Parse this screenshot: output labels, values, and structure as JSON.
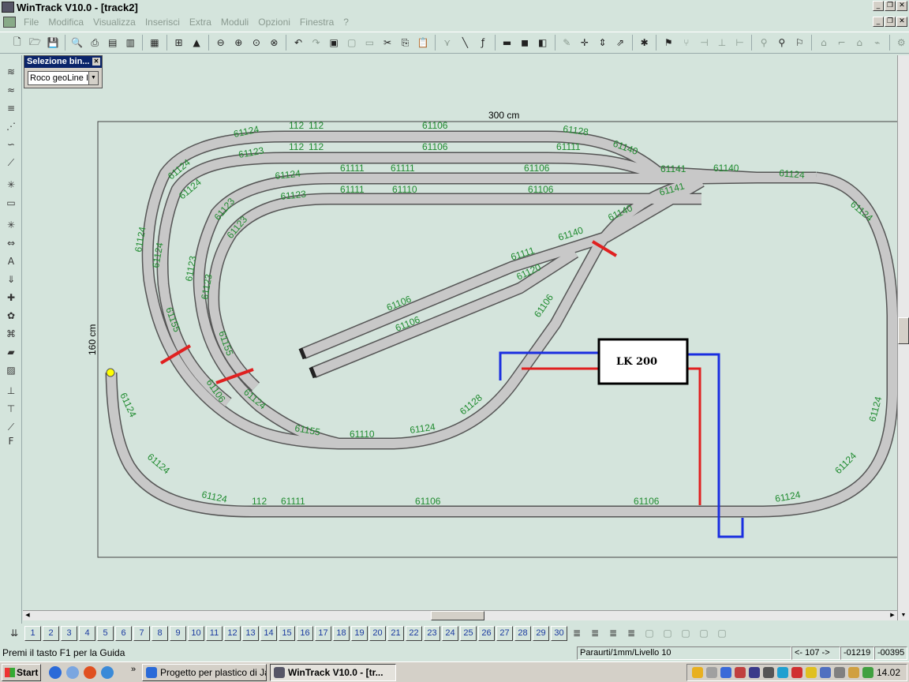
{
  "window": {
    "title": "WinTrack  V10.0 - [track2]"
  },
  "menu": {
    "items": [
      "File",
      "Modifica",
      "Visualizza",
      "Inserisci",
      "Extra",
      "Moduli",
      "Opzioni",
      "Finestra",
      "?"
    ]
  },
  "selection_panel": {
    "title": "Selezione bin...",
    "selected": "Roco geoLine I"
  },
  "dimensions": {
    "width_label": "300 cm",
    "height_label": "160 cm"
  },
  "controller": {
    "label": "LK 200"
  },
  "track_labels": {
    "outer_top": [
      "61124",
      "112",
      "112",
      "61106",
      "61128",
      "61140"
    ],
    "second_top": [
      "61123",
      "112",
      "112",
      "61106",
      "61111",
      "61141",
      "61140"
    ],
    "third_top": [
      "61124",
      "61111",
      "61111",
      "61106"
    ],
    "fourth_top": [
      "61123",
      "61111",
      "61110",
      "61106",
      "61141"
    ],
    "left_curves": [
      "61124",
      "61124",
      "61124",
      "61124",
      "61123",
      "61123",
      "61123",
      "61123",
      "61155",
      "61155"
    ],
    "right_side": [
      "61124",
      "61124",
      "61124",
      "61124"
    ],
    "bottom": [
      "61124",
      "61124",
      "61124",
      "112",
      "61111",
      "61106",
      "61106",
      "61124"
    ],
    "inner_bottom": [
      "61106",
      "61124",
      "61155",
      "61110",
      "61124",
      "61128"
    ],
    "diagonal": [
      "61140",
      "61140",
      "61111",
      "61120",
      "61106",
      "61106",
      "61106"
    ]
  },
  "layers": {
    "numbers": [
      "1",
      "2",
      "3",
      "4",
      "5",
      "6",
      "7",
      "8",
      "9",
      "10",
      "11",
      "12",
      "13",
      "14",
      "15",
      "16",
      "17",
      "18",
      "19",
      "20",
      "21",
      "22",
      "23",
      "24",
      "25",
      "26",
      "27",
      "28",
      "29",
      "30"
    ]
  },
  "statusbar": {
    "help": "Premi il tasto F1 per la Guida",
    "info": "Paraurti/1mm/Livello 10",
    "coord1": "<- 107 ->",
    "coord2": "-01219",
    "coord3": "-00395"
  },
  "taskbar": {
    "start": "Start",
    "task1": "Progetto per plastico di Ja...",
    "task2": "WinTrack  V10.0 - [tr...",
    "clock": "14.02"
  }
}
